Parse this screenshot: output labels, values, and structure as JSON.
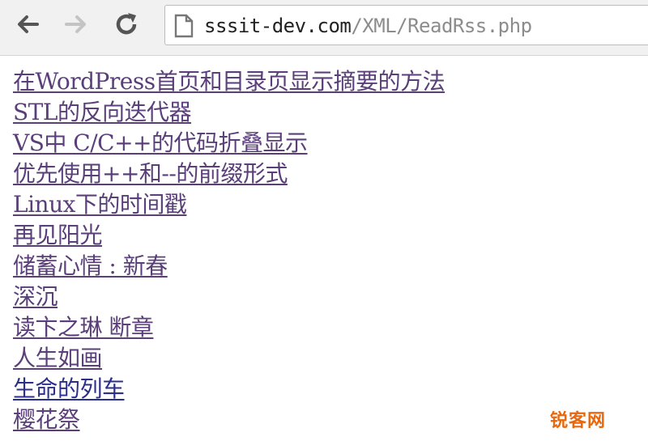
{
  "browser": {
    "url_host": "sssit-dev.com",
    "url_path": "/XML/ReadRss.php",
    "back_icon": "back-arrow-icon",
    "forward_icon": "forward-arrow-icon",
    "reload_icon": "reload-icon",
    "page_icon": "page-icon"
  },
  "links": [
    {
      "text": "在WordPress首页和目录页显示摘要的方法",
      "visited": true
    },
    {
      "text": "STL的反向迭代器",
      "visited": true
    },
    {
      "text": "VS中 C/C++的代码折叠显示",
      "visited": true
    },
    {
      "text": "优先使用++和--的前缀形式",
      "visited": true
    },
    {
      "text": "Linux下的时间戳",
      "visited": true
    },
    {
      "text": "再见阳光",
      "visited": true
    },
    {
      "text": "储蓄心情 : 新春",
      "visited": true
    },
    {
      "text": "深沉",
      "visited": true
    },
    {
      "text": "读卞之琳 断章",
      "visited": true
    },
    {
      "text": "人生如画",
      "visited": true
    },
    {
      "text": "生命的列车",
      "visited": false
    },
    {
      "text": "樱花祭",
      "visited": true
    }
  ],
  "watermark": "锐客网",
  "colors": {
    "visited_link": "#5a3f7a",
    "unvisited_link": "#2b2f8c",
    "watermark": "#e8680f"
  }
}
